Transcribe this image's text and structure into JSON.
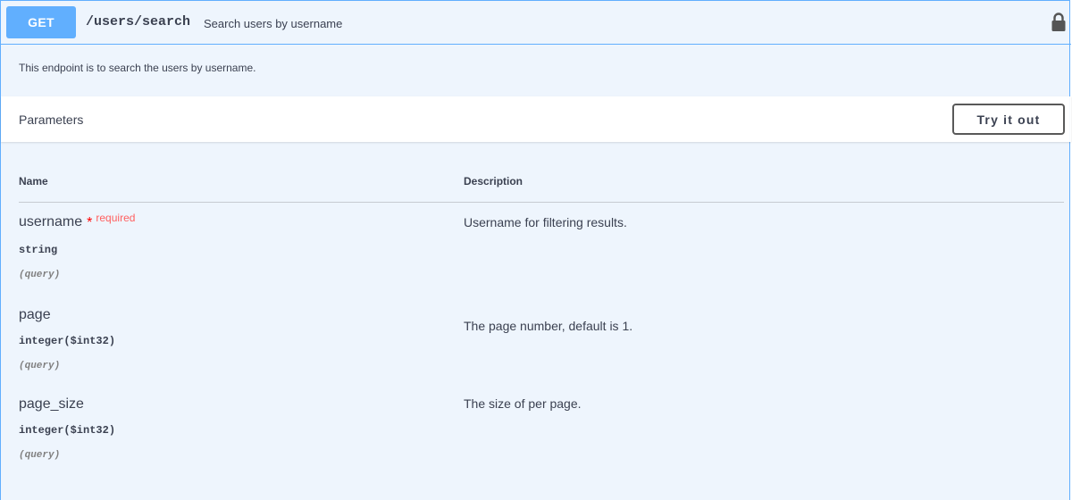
{
  "operation": {
    "method": "GET",
    "path": "/users/search",
    "summary": "Search users by username",
    "description": "This endpoint is to search the users by username.",
    "lock_icon": "lock-icon"
  },
  "parameters_section": {
    "title": "Parameters",
    "try_button": "Try it out",
    "columns": {
      "name": "Name",
      "description": "Description"
    }
  },
  "parameters": [
    {
      "name": "username",
      "required_marker": "*",
      "required_label": "required",
      "type": "string",
      "in": "(query)",
      "description": "Username for filtering results."
    },
    {
      "name": "page",
      "type": "integer($int32)",
      "in": "(query)",
      "description": "The page number, default is 1."
    },
    {
      "name": "page_size",
      "type": "integer($int32)",
      "in": "(query)",
      "description": "The size of per page."
    }
  ],
  "colors": {
    "method_get": "#61affe",
    "block_background": "#eef5fd",
    "required": "#ff6060"
  }
}
